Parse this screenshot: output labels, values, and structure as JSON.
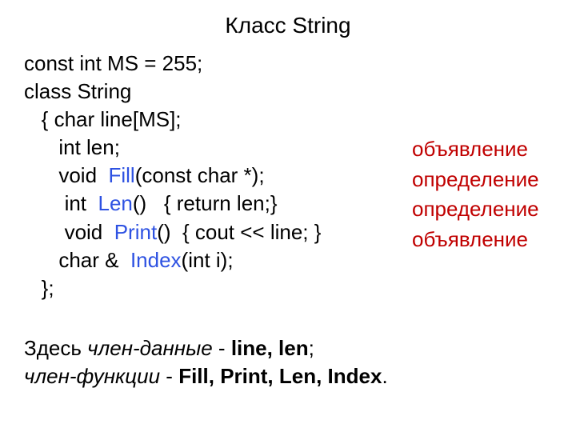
{
  "title": "Класс String",
  "code": {
    "l1": "const int MS = 255;",
    "l2": "class String",
    "l3a": "   { char line[MS];",
    "l4": "      int len;",
    "l5a": "      void  ",
    "l5b": "Fill",
    "l5c": "(const char *);",
    "l6a": "       int  ",
    "l6b": "Len",
    "l6c": "()   { return len;}",
    "l7a": "       void  ",
    "l7b": "Print",
    "l7c": "()  { cout << line; }",
    "l8a": "      char &  ",
    "l8b": "Index",
    "l8c": "(int i);",
    "l9": "   };"
  },
  "annotations": {
    "a1": "объявление",
    "a2": "определение",
    "a3": "определение",
    "a4": "объявление"
  },
  "footer": {
    "p1a": "Здесь ",
    "p1b": "член-данные",
    "p1c": " - ",
    "p1d": "line, len",
    "p1e": ";",
    "p2a": "член-функции",
    "p2b": " - ",
    "p2c": "Fill, Print, Len, Index",
    "p2d": "."
  }
}
